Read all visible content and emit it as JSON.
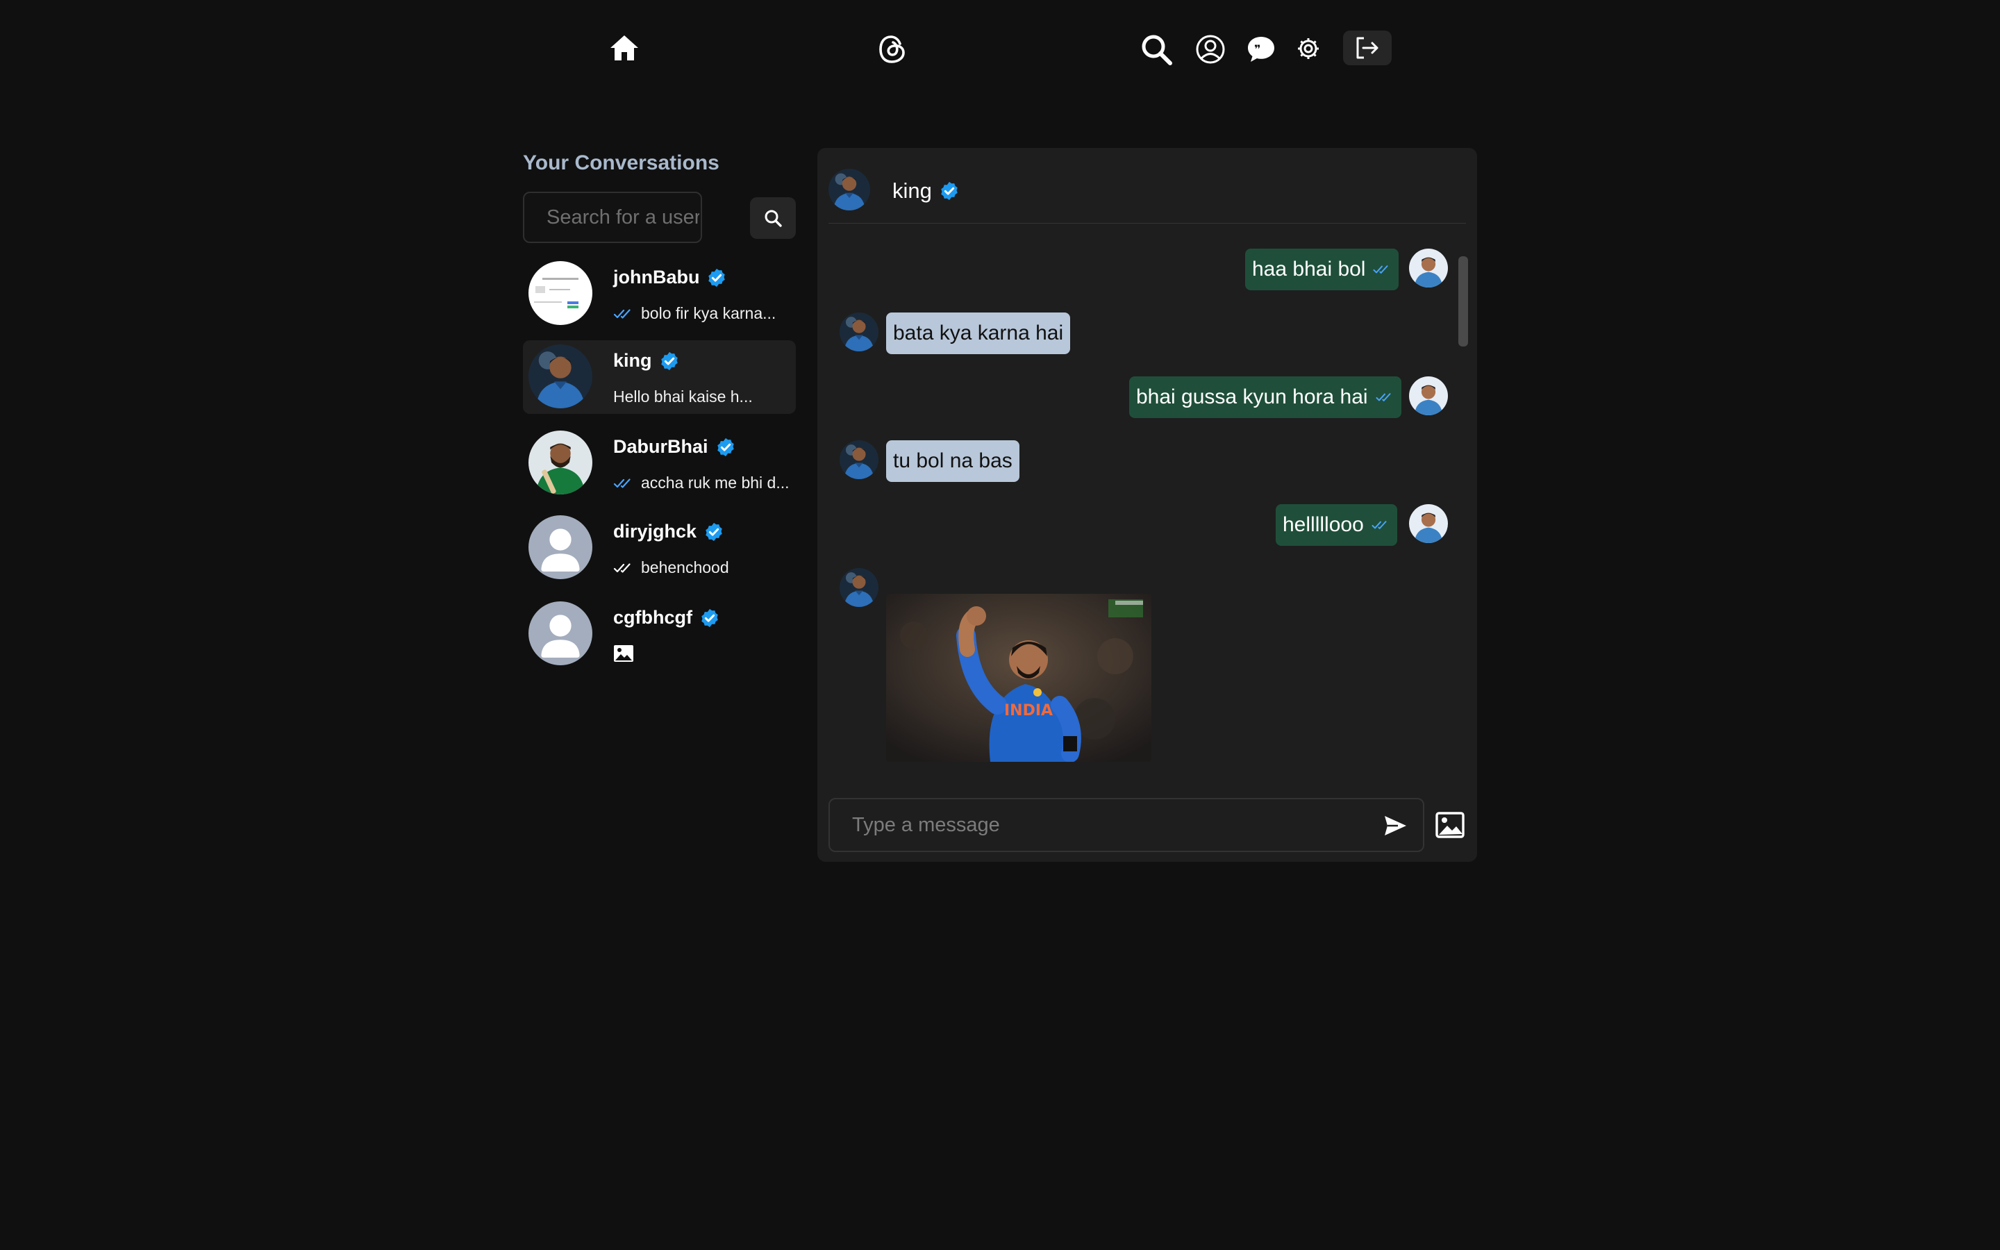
{
  "nav": {
    "icons": [
      "home-icon",
      "threads-logo-icon",
      "search-icon",
      "profile-icon",
      "chat-icon",
      "settings-icon",
      "logout-icon"
    ]
  },
  "sidebar": {
    "title": "Your Conversations",
    "search_placeholder": "Search for a user",
    "conversations": [
      {
        "name": "johnBabu",
        "last_message": "bolo fir kya karna...",
        "seen": true,
        "verified": true,
        "active": false
      },
      {
        "name": "king",
        "last_message": "Hello bhai kaise h...",
        "seen": false,
        "verified": true,
        "active": true
      },
      {
        "name": "DaburBhai",
        "last_message": "accha ruk me bhi d...",
        "seen": true,
        "verified": true,
        "active": false
      },
      {
        "name": "diryjghck",
        "last_message": "behenchood",
        "seen": true,
        "verified": true,
        "active": false
      },
      {
        "name": "cgfbhcgf",
        "last_message": "",
        "last_message_icon": "image-icon",
        "verified": true,
        "active": false
      }
    ]
  },
  "chat": {
    "header_name": "king",
    "verified": true,
    "messages": [
      {
        "direction": "out",
        "text": "haa bhai bol",
        "seen": true
      },
      {
        "direction": "in",
        "text": "bata kya karna hai"
      },
      {
        "direction": "out",
        "text": "bhai gussa kyun hora hai",
        "seen": true
      },
      {
        "direction": "in",
        "text": "tu bol na bas"
      },
      {
        "direction": "out",
        "text": "helllllooo",
        "seen": true
      },
      {
        "direction": "in",
        "type": "image"
      }
    ],
    "input_placeholder": "Type a message"
  },
  "colors": {
    "background": "#101010",
    "panel": "#1e1e1e",
    "outgoing_bubble": "#1f4f3a",
    "incoming_bubble": "#b8c7d9",
    "verified_badge": "#1d9bf0",
    "seen_ticks": "#4aa3ff",
    "title": "#a9b9cc"
  }
}
